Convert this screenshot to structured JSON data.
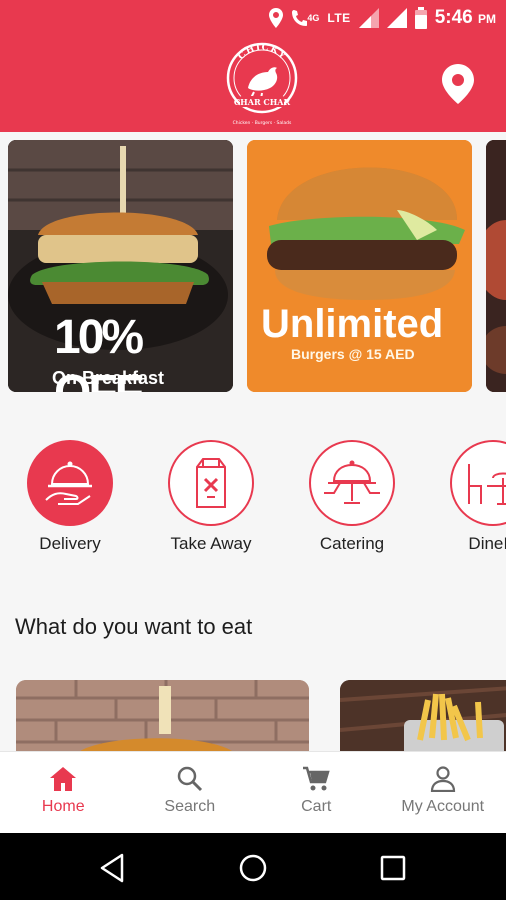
{
  "status": {
    "network": "4G",
    "lte": "LTE",
    "time": "5:46",
    "ampm": "PM"
  },
  "header": {
    "logo_top_text": "CHICKY",
    "logo_bottom_text": "CHAR CHAR",
    "logo_tagline": "Chicken · Burgers · Salads"
  },
  "banners": [
    {
      "headline": "10% OFF",
      "subline": "On Breakfast"
    },
    {
      "headline": "Unlimited",
      "subline": "Burgers @ 15 AED"
    }
  ],
  "services": [
    {
      "label": "Delivery",
      "icon": "cloche-hand-icon",
      "active": true
    },
    {
      "label": "Take Away",
      "icon": "bag-icon"
    },
    {
      "label": "Catering",
      "icon": "catering-icon"
    },
    {
      "label": "DineIn",
      "icon": "dinein-icon"
    }
  ],
  "section": {
    "title": "What do you want to eat"
  },
  "nav": [
    {
      "label": "Home",
      "icon": "home-icon",
      "active": true
    },
    {
      "label": "Search",
      "icon": "search-icon"
    },
    {
      "label": "Cart",
      "icon": "cart-icon"
    },
    {
      "label": "My Account",
      "icon": "account-icon"
    }
  ],
  "colors": {
    "brand": "#e8394f",
    "orange": "#ef8a2b"
  }
}
